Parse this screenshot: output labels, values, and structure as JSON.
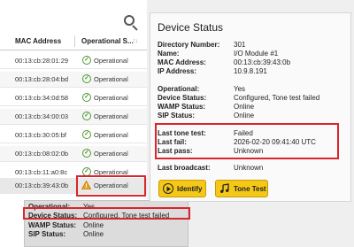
{
  "table": {
    "columns": {
      "mac": "MAC Address",
      "status": "Operational S..."
    },
    "rows": [
      {
        "mac": "00:13:cb:28:01:29",
        "status": "Operational",
        "state": "ok"
      },
      {
        "mac": "00:13:cb:28:04:bd",
        "status": "Operational",
        "state": "ok"
      },
      {
        "mac": "00:13:cb:34:0d:58",
        "status": "Operational",
        "state": "ok"
      },
      {
        "mac": "00:13:cb:34:00:03",
        "status": "Operational",
        "state": "ok"
      },
      {
        "mac": "00:13:cb:30:05:bf",
        "status": "Operational",
        "state": "ok"
      },
      {
        "mac": "00:13:cb:08:02:0b",
        "status": "Operational",
        "state": "ok"
      },
      {
        "mac": "00:13:cb:11:a0:8c",
        "status": "Operational",
        "state": "ok"
      },
      {
        "mac": "00:13:cb:39:43:0b",
        "status": "Operational",
        "state": "warn"
      }
    ]
  },
  "tooltip": {
    "rows": [
      {
        "k": "Operational:",
        "v": "Yes"
      },
      {
        "k": "Device Status:",
        "v": "Configured, Tone test failed"
      },
      {
        "k": "WAMP Status:",
        "v": "Online"
      },
      {
        "k": "SIP Status:",
        "v": "Online"
      }
    ]
  },
  "details": {
    "title": "Device Status",
    "directory_number": {
      "k": "Directory Number:",
      "v": "301"
    },
    "name": {
      "k": "Name:",
      "v": "I/O Module #1"
    },
    "mac": {
      "k": "MAC Address:",
      "v": "00:13:cb:39:43:0b"
    },
    "ip": {
      "k": "IP Address:",
      "v": "10.9.8.191"
    },
    "operational": {
      "k": "Operational:",
      "v": "Yes"
    },
    "device_status": {
      "k": "Device Status:",
      "v": "Configured, Tone test failed"
    },
    "wamp": {
      "k": "WAMP Status:",
      "v": "Online"
    },
    "sip": {
      "k": "SIP Status:",
      "v": "Online"
    },
    "last_tone": {
      "k": "Last tone test:",
      "v": "Failed"
    },
    "last_fail": {
      "k": "Last fail:",
      "v": "2026-02-20 09:41:40 UTC"
    },
    "last_pass": {
      "k": "Last pass:",
      "v": "Unknown"
    },
    "last_broadcast": {
      "k": "Last broadcast:",
      "v": "Unknown"
    },
    "identify_label": "Identify",
    "tone_test_label": "Tone Test"
  },
  "colors": {
    "highlight": "#d9252e",
    "button": "#f5c818",
    "ok": "#4a9a2c",
    "warn": "#f0a020"
  }
}
